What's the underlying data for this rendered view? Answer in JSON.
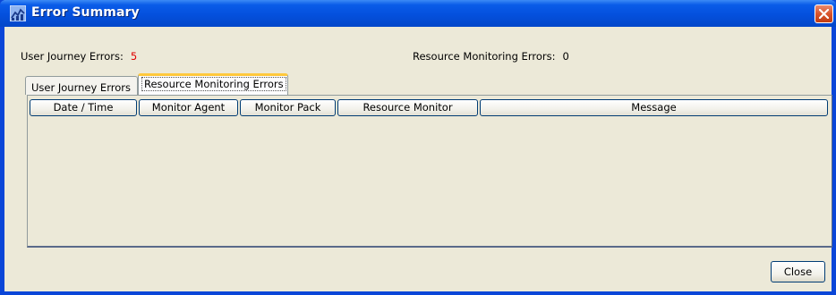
{
  "window": {
    "title": "Error Summary"
  },
  "summary": {
    "user_journey_label": "User Journey Errors:",
    "user_journey_count": "5",
    "resource_monitoring_label": "Resource Monitoring Errors:",
    "resource_monitoring_count": "0"
  },
  "tabs": [
    {
      "label": "User Journey Errors",
      "selected": false
    },
    {
      "label": "Resource Monitoring Errors",
      "selected": true
    }
  ],
  "table": {
    "columns": [
      "Date / Time",
      "Monitor Agent",
      "Monitor Pack",
      "Resource Monitor",
      "Message"
    ],
    "rows": []
  },
  "buttons": {
    "close_label": "Close"
  },
  "colors": {
    "titlebar_blue": "#0450dd",
    "error_count_red": "#e00000",
    "window_face": "#ece9d8",
    "selected_tab_accent": "#ffc83c"
  },
  "icons": {
    "window_icon": "chart-window-icon",
    "title_close": "close-icon"
  }
}
